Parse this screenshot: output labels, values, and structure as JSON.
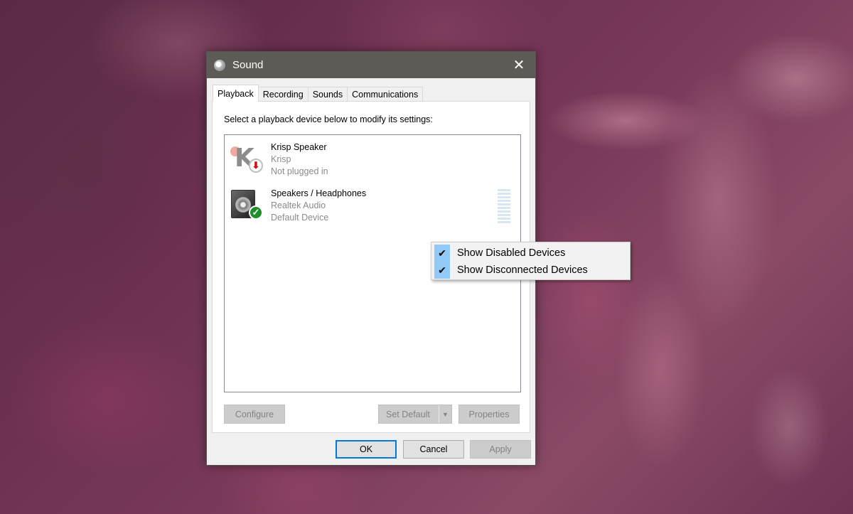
{
  "window": {
    "title": "Sound",
    "close_glyph": "✕"
  },
  "tabs": [
    {
      "label": "Playback",
      "active": true
    },
    {
      "label": "Recording",
      "active": false
    },
    {
      "label": "Sounds",
      "active": false
    },
    {
      "label": "Communications",
      "active": false
    }
  ],
  "playback": {
    "instructions": "Select a playback device below to modify its settings:",
    "devices": [
      {
        "name": "Krisp Speaker",
        "driver": "Krisp",
        "status": "Not plugged in",
        "icon": "krisp-icon",
        "badge": "unplugged-arrow-icon"
      },
      {
        "name": "Speakers / Headphones",
        "driver": "Realtek Audio",
        "status": "Default Device",
        "icon": "speaker-icon",
        "badge": "default-check-icon"
      }
    ],
    "buttons": {
      "configure": "Configure",
      "set_default": "Set Default",
      "properties": "Properties"
    }
  },
  "dialog_buttons": {
    "ok": "OK",
    "cancel": "Cancel",
    "apply": "Apply"
  },
  "context_menu": {
    "items": [
      {
        "label": "Show Disabled Devices",
        "checked": true
      },
      {
        "label": "Show Disconnected Devices",
        "checked": true
      }
    ]
  },
  "colors": {
    "titlebar": "#5e5a55",
    "default_badge": "#1e8f2a",
    "unplugged_arrow": "#d01010",
    "menu_check_highlight": "#91c9f7",
    "focus_border": "#0078d7"
  }
}
